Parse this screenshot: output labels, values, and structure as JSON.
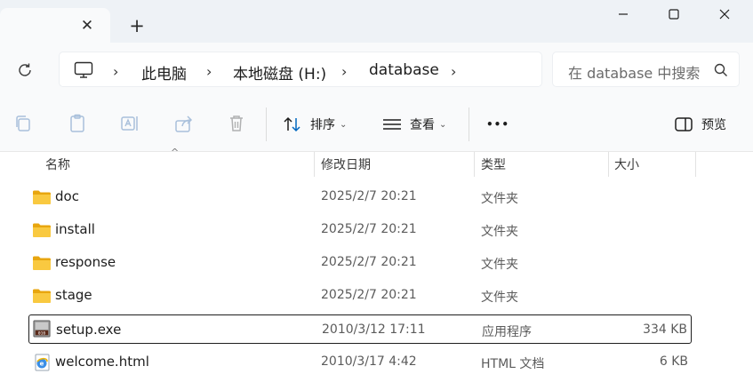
{
  "window": {
    "new_tab_symbol": "+",
    "close_tab_symbol": "✕"
  },
  "address": {
    "crumbs": [
      "此电脑",
      "本地磁盘 (H:)",
      "database"
    ],
    "search_placeholder": "在 database 中搜索"
  },
  "toolbar": {
    "sort_label": "排序",
    "view_label": "查看",
    "more_label": "•••",
    "preview_label": "预览"
  },
  "columns": {
    "name": "名称",
    "modified": "修改日期",
    "type": "类型",
    "size": "大小"
  },
  "files": [
    {
      "name": "doc",
      "modified": "2025/2/7 20:21",
      "type": "文件夹",
      "size": "",
      "icon": "folder-icon"
    },
    {
      "name": "install",
      "modified": "2025/2/7 20:21",
      "type": "文件夹",
      "size": "",
      "icon": "folder-icon"
    },
    {
      "name": "response",
      "modified": "2025/2/7 20:21",
      "type": "文件夹",
      "size": "",
      "icon": "folder-icon"
    },
    {
      "name": "stage",
      "modified": "2025/2/7 20:21",
      "type": "文件夹",
      "size": "",
      "icon": "folder-icon"
    },
    {
      "name": "setup.exe",
      "modified": "2010/3/12 17:11",
      "type": "应用程序",
      "size": "334 KB",
      "icon": "exe-icon",
      "selected": true
    },
    {
      "name": "welcome.html",
      "modified": "2010/3/17 4:42",
      "type": "HTML 文档",
      "size": "6 KB",
      "icon": "html-icon"
    }
  ],
  "colors": {
    "folder": "#f5c33b",
    "accent": "#0067c0"
  }
}
